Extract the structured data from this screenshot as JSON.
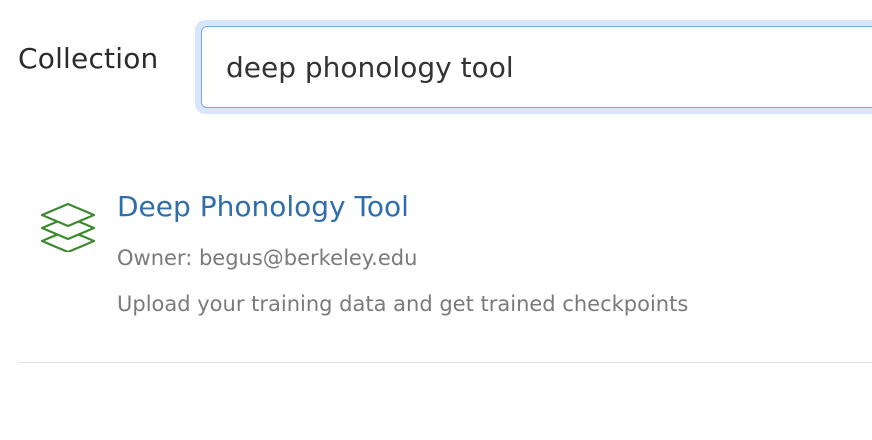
{
  "search": {
    "label": "Collection",
    "value": "deep phonology tool"
  },
  "results": [
    {
      "icon": "layers-icon",
      "title": "Deep Phonology Tool",
      "owner": "Owner: begus@berkeley.edu",
      "description": "Upload your training data and get trained checkpoints"
    }
  ],
  "colors": {
    "link": "#2f6ea8",
    "icon": "#3b8a2e",
    "focus_ring": "#d8e6fb",
    "meta_text": "#7a7a7a"
  }
}
